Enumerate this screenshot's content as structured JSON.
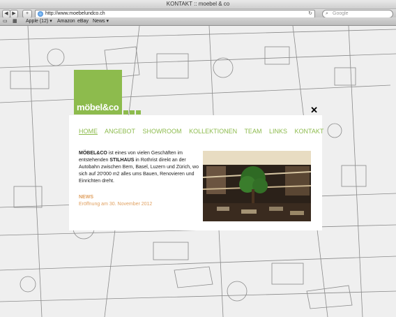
{
  "window": {
    "title": "KONTAKT :: moebel & co"
  },
  "toolbar": {
    "url": "http://www.moebelundco.ch",
    "search_placeholder": "Google"
  },
  "bookmarks": [
    {
      "label": "Apple (12) ▾"
    },
    {
      "label": "Amazon"
    },
    {
      "label": "eBay"
    },
    {
      "label": "News ▾"
    }
  ],
  "logo": {
    "text": "möbel&co"
  },
  "nav": {
    "items": [
      {
        "label": "HOME",
        "active": true
      },
      {
        "label": "ANGEBOT"
      },
      {
        "label": "SHOWROOM"
      },
      {
        "label": "KOLLEKTIONEN"
      },
      {
        "label": "TEAM"
      },
      {
        "label": "LINKS"
      },
      {
        "label": "KONTAKT"
      }
    ]
  },
  "intro": {
    "brand": "MÖBEL&CO",
    "text_a": " ist eines von vielen Geschäften im entstehenden ",
    "place": "STILHAUS",
    "text_b": " in Rothrist direkt an der Autobahn zwischen Bern, Basel, Luzern und Zürich, wo sich auf 20'000 m2 alles ums Bauen, Renovieren und Einrichten dreht."
  },
  "news": {
    "heading": "NEWS",
    "text": "Eröffnung am 30. November 2012"
  },
  "colors": {
    "accent": "#8dbb4d",
    "news": "#e0a060"
  }
}
